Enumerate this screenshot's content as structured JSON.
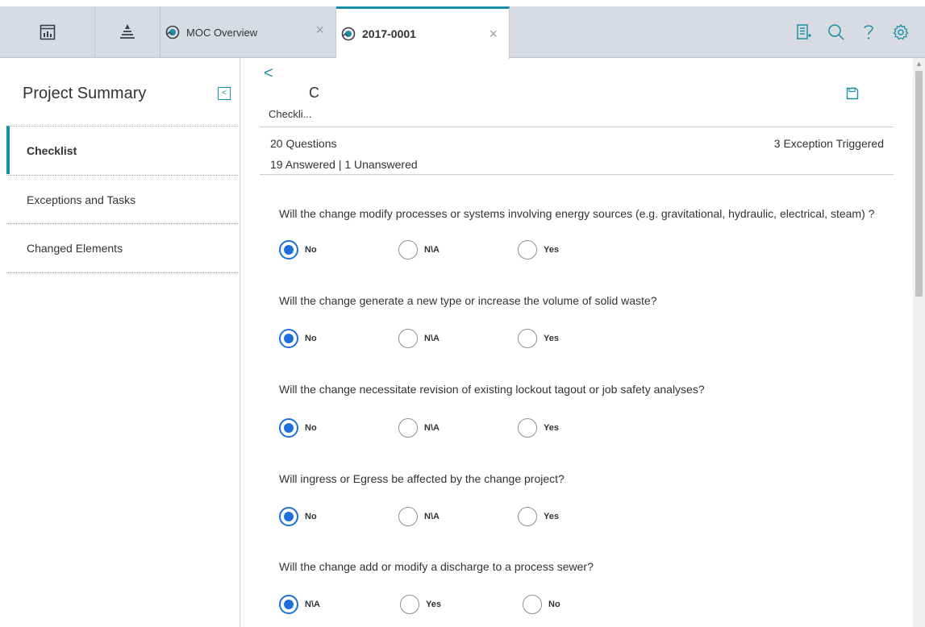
{
  "tabs": {
    "moc_label": "MOC Overview",
    "active_label": "2017-0001",
    "close_glyph": "×"
  },
  "toolbar_icons": [
    "dashboard-icon",
    "hierarchy-icon",
    "worklist-icon",
    "search-icon",
    "help-icon",
    "settings-icon"
  ],
  "colors": {
    "accent": "#1a8ea6",
    "radio_selected": "#1e6fd9"
  },
  "sidebar": {
    "title": "Project Summary",
    "collapse_glyph": "<",
    "items": [
      {
        "label": "Checklist",
        "active": true
      },
      {
        "label": "Exceptions and Tasks",
        "active": false
      },
      {
        "label": "Changed Elements",
        "active": false
      }
    ]
  },
  "header": {
    "back_glyph": "<",
    "letter": "C",
    "subtitle": "Checkli...",
    "questions": "20 Questions",
    "answered": "19 Answered | 1 Unanswered",
    "exceptions": "3 Exception Triggered"
  },
  "questions": [
    {
      "text": "Will the change modify processes or systems involving energy sources (e.g. gravitational, hydraulic, electrical, steam) ?",
      "options": [
        {
          "label": "No",
          "selected": true
        },
        {
          "label": "N\\A",
          "selected": false
        },
        {
          "label": "Yes",
          "selected": false
        }
      ]
    },
    {
      "text": "Will the change generate a new type or increase the volume of solid waste?",
      "options": [
        {
          "label": "No",
          "selected": true
        },
        {
          "label": "N\\A",
          "selected": false
        },
        {
          "label": "Yes",
          "selected": false
        }
      ]
    },
    {
      "text": "Will the change necessitate revision of existing lockout tagout or job safety analyses?",
      "options": [
        {
          "label": "No",
          "selected": true
        },
        {
          "label": "N\\A",
          "selected": false
        },
        {
          "label": "Yes",
          "selected": false
        }
      ]
    },
    {
      "text": "Will ingress or Egress be affected by the change project?",
      "options": [
        {
          "label": "No",
          "selected": true
        },
        {
          "label": "N\\A",
          "selected": false
        },
        {
          "label": "Yes",
          "selected": false
        }
      ]
    },
    {
      "text": "Will the change add or modify a discharge to a process sewer?",
      "options": [
        {
          "label": "N\\A",
          "selected": true
        },
        {
          "label": "Yes",
          "selected": false
        },
        {
          "label": "No",
          "selected": false
        }
      ]
    }
  ]
}
